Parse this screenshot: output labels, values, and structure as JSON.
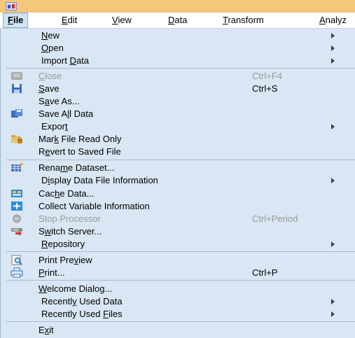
{
  "menubar": {
    "items": [
      {
        "label": "File",
        "mnemonic": "F",
        "rest": "ile"
      },
      {
        "label": "Edit",
        "mnemonic": "E",
        "rest": "dit"
      },
      {
        "label": "View",
        "mnemonic": "V",
        "rest": "iew"
      },
      {
        "label": "Data",
        "mnemonic": "D",
        "rest": "ata"
      },
      {
        "label": "Transform",
        "mnemonic": "T",
        "rest": "ransform"
      },
      {
        "label": "Analyz",
        "mnemonic": "A",
        "rest": "nalyz"
      }
    ]
  },
  "file_menu": {
    "items": [
      {
        "pre": "",
        "u": "N",
        "post": "ew",
        "shortcut": "",
        "submenu": true,
        "icon": "",
        "disabled": false
      },
      {
        "pre": "",
        "u": "O",
        "post": "pen",
        "shortcut": "",
        "submenu": true,
        "icon": "",
        "disabled": false
      },
      {
        "pre": "Import ",
        "u": "D",
        "post": "ata",
        "shortcut": "",
        "submenu": true,
        "icon": "",
        "disabled": false
      },
      {
        "pre": "",
        "u": "C",
        "post": "lose",
        "shortcut": "Ctrl+F4",
        "submenu": false,
        "icon": "close-window-icon",
        "disabled": true
      },
      {
        "pre": "",
        "u": "S",
        "post": "ave",
        "shortcut": "Ctrl+S",
        "submenu": false,
        "icon": "floppy-disk-icon",
        "disabled": false
      },
      {
        "pre": "S",
        "u": "a",
        "post": "ve As...",
        "shortcut": "",
        "submenu": false,
        "icon": "",
        "disabled": false
      },
      {
        "pre": "Save A",
        "u": "l",
        "post": "l Data",
        "shortcut": "",
        "submenu": false,
        "icon": "save-all-icon",
        "disabled": false
      },
      {
        "pre": "Expor",
        "u": "t",
        "post": "",
        "shortcut": "",
        "submenu": true,
        "icon": "",
        "disabled": false
      },
      {
        "pre": "Mar",
        "u": "k",
        "post": " File Read Only",
        "shortcut": "",
        "submenu": false,
        "icon": "lock-folder-icon",
        "disabled": false
      },
      {
        "pre": "R",
        "u": "e",
        "post": "vert to Saved File",
        "shortcut": "",
        "submenu": false,
        "icon": "",
        "disabled": false
      },
      {
        "pre": "Rena",
        "u": "m",
        "post": "e Dataset...",
        "shortcut": "",
        "submenu": false,
        "icon": "rename-dataset-icon",
        "disabled": false
      },
      {
        "pre": "D",
        "u": "i",
        "post": "splay Data File Information",
        "shortcut": "",
        "submenu": true,
        "icon": "",
        "disabled": false
      },
      {
        "pre": "Cac",
        "u": "h",
        "post": "e Data...",
        "shortcut": "",
        "submenu": false,
        "icon": "cache-data-icon",
        "disabled": false
      },
      {
        "pre": "Collect Variable Information",
        "u": "",
        "post": "",
        "shortcut": "",
        "submenu": false,
        "icon": "collect-info-icon",
        "disabled": false
      },
      {
        "pre": "Stop Processor",
        "u": "",
        "post": "",
        "shortcut": "Ctrl+Period",
        "submenu": false,
        "icon": "stop-processor-icon",
        "disabled": true
      },
      {
        "pre": "S",
        "u": "w",
        "post": "itch Server...",
        "shortcut": "",
        "submenu": false,
        "icon": "switch-server-icon",
        "disabled": false
      },
      {
        "pre": "",
        "u": "R",
        "post": "epository",
        "shortcut": "",
        "submenu": true,
        "icon": "",
        "disabled": false
      },
      {
        "pre": "Print Pre",
        "u": "v",
        "post": "iew",
        "shortcut": "",
        "submenu": false,
        "icon": "print-preview-icon",
        "disabled": false
      },
      {
        "pre": "",
        "u": "P",
        "post": "rint...",
        "shortcut": "Ctrl+P",
        "submenu": false,
        "icon": "printer-icon",
        "disabled": false
      },
      {
        "pre": "",
        "u": "W",
        "post": "elcome Dialog...",
        "shortcut": "",
        "submenu": false,
        "icon": "",
        "disabled": false
      },
      {
        "pre": "Recentl",
        "u": "y",
        "post": " Used Data",
        "shortcut": "",
        "submenu": true,
        "icon": "",
        "disabled": false
      },
      {
        "pre": "Recently Used ",
        "u": "F",
        "post": "iles",
        "shortcut": "",
        "submenu": true,
        "icon": "",
        "disabled": false
      },
      {
        "pre": "E",
        "u": "x",
        "post": "it",
        "shortcut": "",
        "submenu": false,
        "icon": "",
        "disabled": false
      }
    ]
  },
  "colors": {
    "title_bar": "#f4c779",
    "menu_background": "#d9e6f3",
    "active_menubar_item": "#cfe3f7",
    "disabled_text": "#9a9a9a"
  }
}
